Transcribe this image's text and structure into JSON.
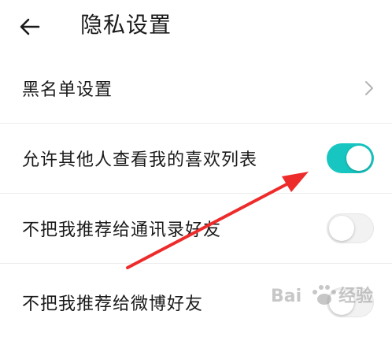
{
  "header": {
    "title": "隐私设置",
    "back_icon": "arrow-left-icon"
  },
  "settings": [
    {
      "label": "黑名单设置",
      "control": "chevron",
      "icon": "chevron-right-icon"
    },
    {
      "label": "允许其他人查看我的喜欢列表",
      "control": "toggle",
      "checked": true
    },
    {
      "label": "不把我推荐给通讯录好友",
      "control": "toggle",
      "checked": false
    },
    {
      "label": "不把我推荐给微博好友",
      "control": "toggle",
      "checked": false
    }
  ],
  "colors": {
    "toggle_on": "#18c6c1",
    "toggle_off": "#f2f2f2",
    "annotation_arrow": "#ee2b2b",
    "divider": "#ececec"
  },
  "watermark": {
    "brand": "Baidu",
    "text": "经验"
  }
}
